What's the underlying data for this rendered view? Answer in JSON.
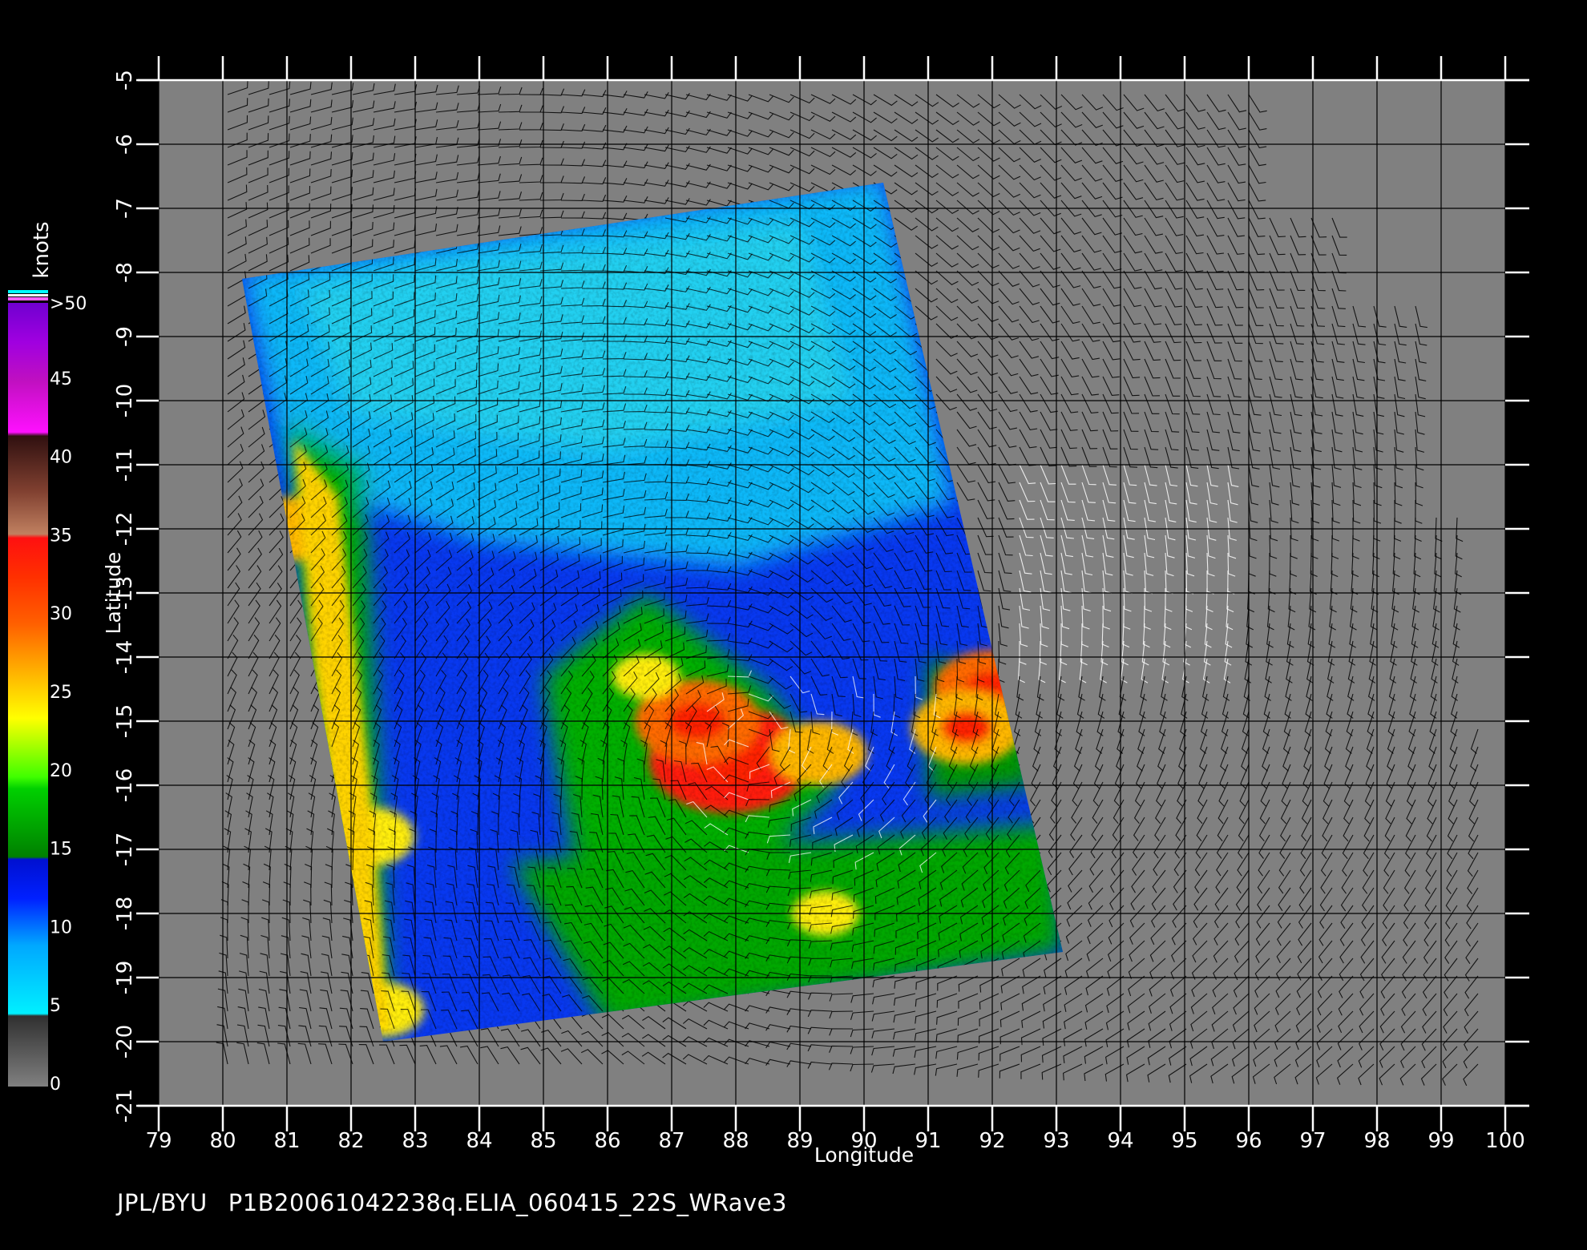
{
  "map": {
    "x_axis_label": "Longitude",
    "y_axis_label": "Latitude",
    "lon_range": [
      79,
      100
    ],
    "lat_range": [
      -21,
      -5
    ],
    "lon_ticks": [
      "79",
      "80",
      "81",
      "82",
      "83",
      "84",
      "85",
      "86",
      "87",
      "88",
      "89",
      "90",
      "91",
      "92",
      "93",
      "94",
      "95",
      "96",
      "97",
      "98",
      "99",
      "100"
    ],
    "lat_ticks": [
      "-5",
      "-6",
      "-7",
      "-8",
      "-9",
      "-10",
      "-11",
      "-12",
      "-13",
      "-14",
      "-15",
      "-16",
      "-17",
      "-18",
      "-19",
      "-20",
      "-21"
    ],
    "background_color": "#808080",
    "swath_corners_lonlat": [
      [
        80.3,
        -8.1
      ],
      [
        90.3,
        -6.6
      ],
      [
        93.1,
        -18.6
      ],
      [
        82.5,
        -20.0
      ]
    ],
    "wind_cores": [
      {
        "lon": 87.9,
        "lat": -15.6,
        "knots": 33
      },
      {
        "lon": 87.4,
        "lat": -15.0,
        "knots": 28
      },
      {
        "lon": 86.6,
        "lat": -14.3,
        "knots": 20
      },
      {
        "lon": 81.1,
        "lat": -12.0,
        "knots": 24
      },
      {
        "lon": 82.3,
        "lat": -16.8,
        "knots": 23
      },
      {
        "lon": 82.5,
        "lat": -19.5,
        "knots": 22
      },
      {
        "lon": 92.0,
        "lat": -14.5,
        "knots": 27
      },
      {
        "lon": 91.6,
        "lat": -15.1,
        "knots": 26
      },
      {
        "lon": 89.3,
        "lat": -15.5,
        "knots": 24
      },
      {
        "lon": 89.4,
        "lat": -18.0,
        "knots": 20
      }
    ]
  },
  "legend": {
    "unit": "knots",
    "labels": [
      ">50",
      "45",
      "40",
      "35",
      "30",
      "25",
      "20",
      "15",
      "10",
      "5",
      "0"
    ],
    "colors": {
      "c0": "#505050",
      "c5": "#00e8ff",
      "c10": "#0030ff",
      "c15": "#00a000",
      "c20": "#ffff00",
      "c25": "#ff8000",
      "c30": "#ff2000",
      "c35": "#c88060",
      "c40": "#ff00ff",
      "c50": "#8000ff"
    }
  },
  "footer": {
    "source": "JPL/BYU",
    "file_id": "P1B20061042238q.ELIA_060415_22S_WRave3"
  }
}
